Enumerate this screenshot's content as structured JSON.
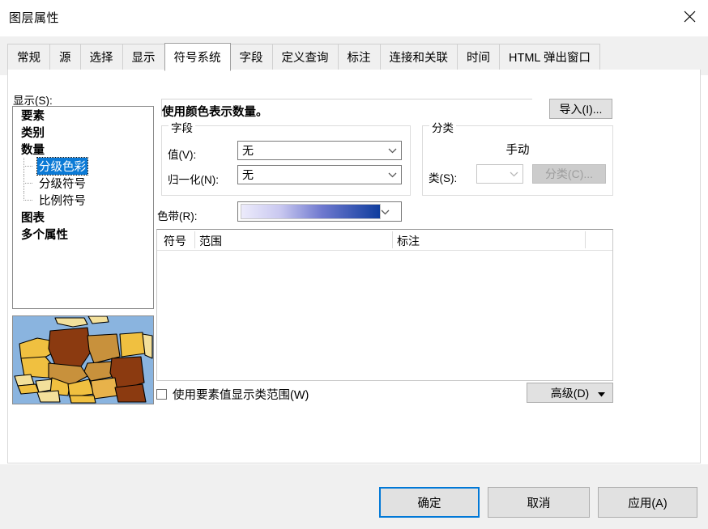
{
  "window": {
    "title": "图层属性",
    "close_icon": "close-icon"
  },
  "tabs": [
    {
      "label": "常规",
      "selected": false
    },
    {
      "label": "源",
      "selected": false
    },
    {
      "label": "选择",
      "selected": false
    },
    {
      "label": "显示",
      "selected": false
    },
    {
      "label": "符号系统",
      "selected": true
    },
    {
      "label": "字段",
      "selected": false
    },
    {
      "label": "定义查询",
      "selected": false
    },
    {
      "label": "标注",
      "selected": false
    },
    {
      "label": "连接和关联",
      "selected": false
    },
    {
      "label": "时间",
      "selected": false
    },
    {
      "label": "HTML 弹出窗口",
      "selected": false
    }
  ],
  "sidebar": {
    "label": "显示(S):",
    "items": [
      {
        "label": "要素",
        "level": 0,
        "selected": false
      },
      {
        "label": "类别",
        "level": 0,
        "selected": false
      },
      {
        "label": "数量",
        "level": 0,
        "selected": false
      },
      {
        "label": "分级色彩",
        "level": 1,
        "selected": true
      },
      {
        "label": "分级符号",
        "level": 1,
        "selected": false
      },
      {
        "label": "比例符号",
        "level": 1,
        "selected": false
      },
      {
        "label": "图表",
        "level": 0,
        "selected": false
      },
      {
        "label": "多个属性",
        "level": 0,
        "selected": false
      }
    ]
  },
  "preview": {
    "name": "map-thumbnail",
    "ocean_color": "#8ab4df",
    "fills": [
      "#f5e39a",
      "#f0c040",
      "#d2a048",
      "#c8913c",
      "#8b3a10",
      "#e8b24a"
    ]
  },
  "main": {
    "description": "使用颜色表示数量。",
    "import_button": "导入(I)...",
    "field_group": {
      "title": "字段",
      "value_label": "值(V):",
      "value_selected": "无",
      "normalize_label": "归一化(N):",
      "normalize_selected": "无"
    },
    "classification_group": {
      "title": "分类",
      "method": "手动",
      "classes_label": "类(S):",
      "classes_value": "",
      "classify_button": "分类(C)..."
    },
    "color_ramp": {
      "label": "色带(R):",
      "from_color": "#ecebfb",
      "to_color": "#0f3d9e"
    },
    "table": {
      "columns": [
        "符号",
        "范围",
        "标注"
      ],
      "rows": []
    },
    "use_feature_values_checkbox": {
      "label": "使用要素值显示类范围(W)",
      "checked": false
    },
    "advanced_button": "高级(D)"
  },
  "footer": {
    "ok": "确定",
    "cancel": "取消",
    "apply": "应用(A)",
    "default_accent": "#0078d7"
  }
}
